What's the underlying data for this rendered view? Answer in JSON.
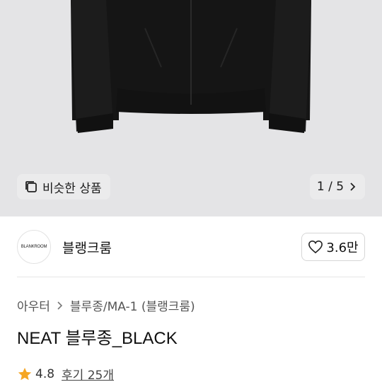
{
  "gallery": {
    "similar_label": "비슷한 상품",
    "pager_label": "1 / 5"
  },
  "shop": {
    "logo_text": "BLANKROOM",
    "name": "블랭크룸",
    "likes": "3.6만"
  },
  "breadcrumb": {
    "category": "아우터",
    "subcategory": "블루종/MA-1 (블랭크룸)"
  },
  "product": {
    "title": "NEAT 블루종_BLACK",
    "rating": "4.8",
    "reviews_label": "후기 25개"
  },
  "colors": {
    "star": "#f5a623",
    "hero_bg": "#e4e4e6",
    "jacket": "#1a1a1a"
  }
}
